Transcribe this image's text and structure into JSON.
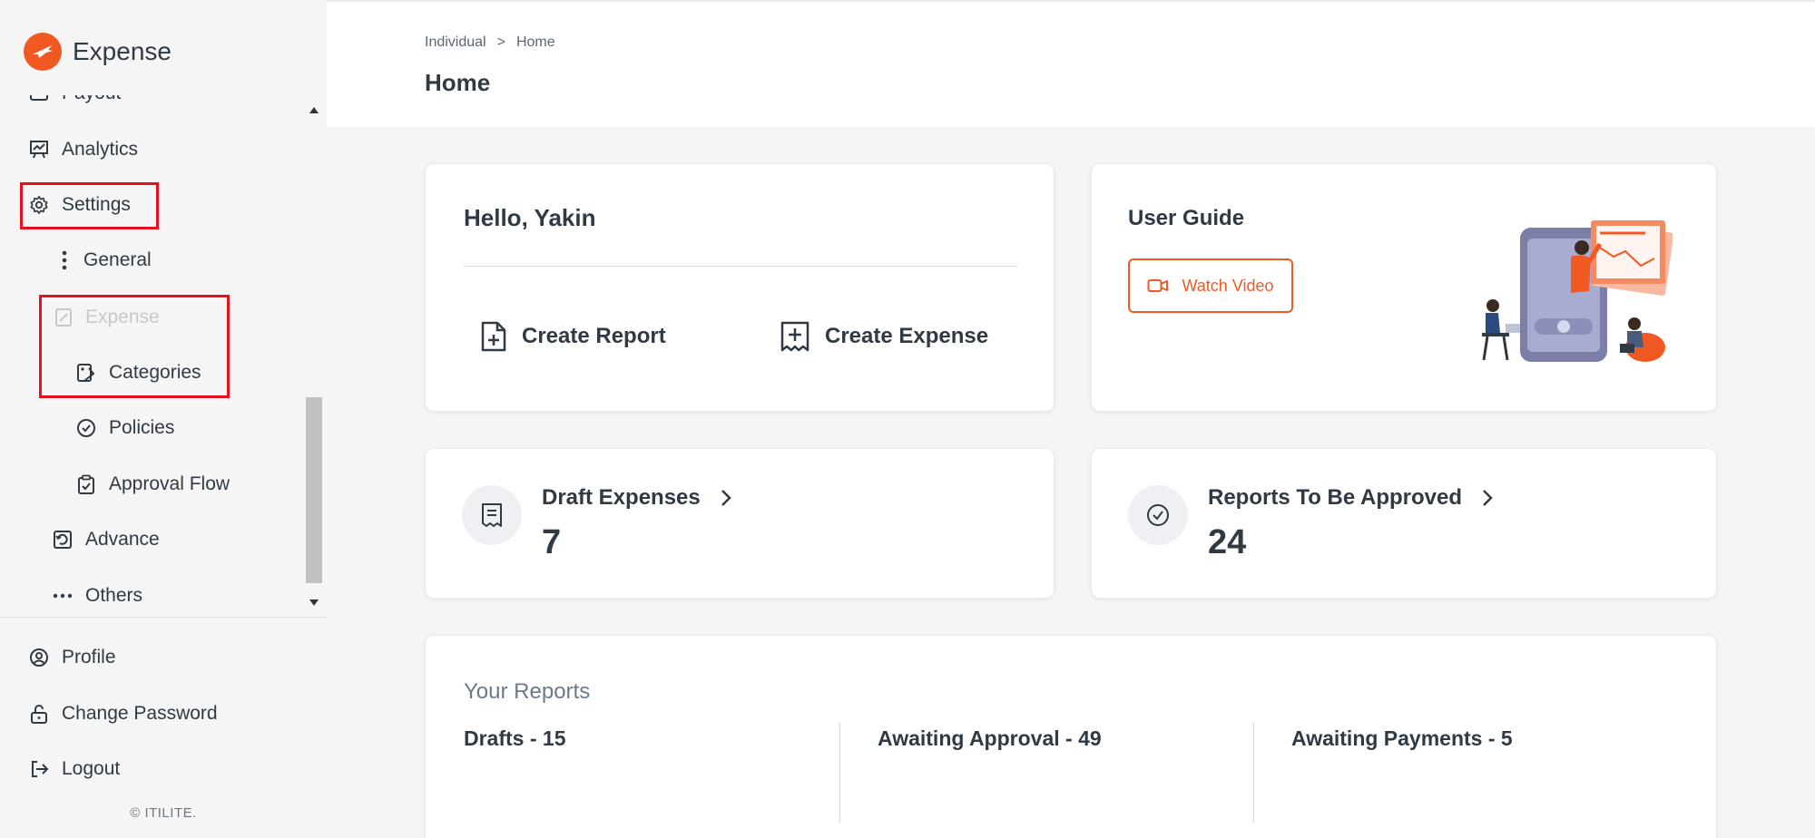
{
  "brand": {
    "name": "Expense",
    "color": "#f05a22"
  },
  "sidebar": {
    "partial_item": "Payout",
    "items": [
      {
        "label": "Analytics",
        "icon": "analytics-icon"
      },
      {
        "label": "Settings",
        "icon": "gear-icon"
      },
      {
        "label": "General",
        "icon": "vertical-dots-icon"
      },
      {
        "label": "Expense",
        "icon": "expense-doc-icon",
        "disabled": true
      },
      {
        "label": "Categories",
        "icon": "categories-icon"
      },
      {
        "label": "Policies",
        "icon": "check-circle-icon"
      },
      {
        "label": "Approval Flow",
        "icon": "clipboard-check-icon"
      },
      {
        "label": "Advance",
        "icon": "advance-icon"
      },
      {
        "label": "Others",
        "icon": "horizontal-dots-icon"
      }
    ],
    "bottom_items": [
      {
        "label": "Profile",
        "icon": "user-circle-icon"
      },
      {
        "label": "Change Password",
        "icon": "lock-icon"
      },
      {
        "label": "Logout",
        "icon": "logout-icon"
      }
    ],
    "copyright": "© ITILITE."
  },
  "header": {
    "breadcrumb": [
      "Individual",
      ">",
      "Home"
    ],
    "title": "Home"
  },
  "greeting_card": {
    "greeting": "Hello, Yakin",
    "create_report": "Create Report",
    "create_expense": "Create Expense"
  },
  "guide_card": {
    "title": "User Guide",
    "watch_video": "Watch Video"
  },
  "stats": {
    "draft_label": "Draft Expenses",
    "draft_value": "7",
    "approve_label": "Reports To Be Approved",
    "approve_value": "24"
  },
  "reports": {
    "title": "Your Reports",
    "columns": [
      "Drafts - 15",
      "Awaiting Approval - 49",
      "Awaiting Payments - 5"
    ]
  },
  "colors": {
    "accent": "#f05a22",
    "highlight": "#e3101e"
  }
}
